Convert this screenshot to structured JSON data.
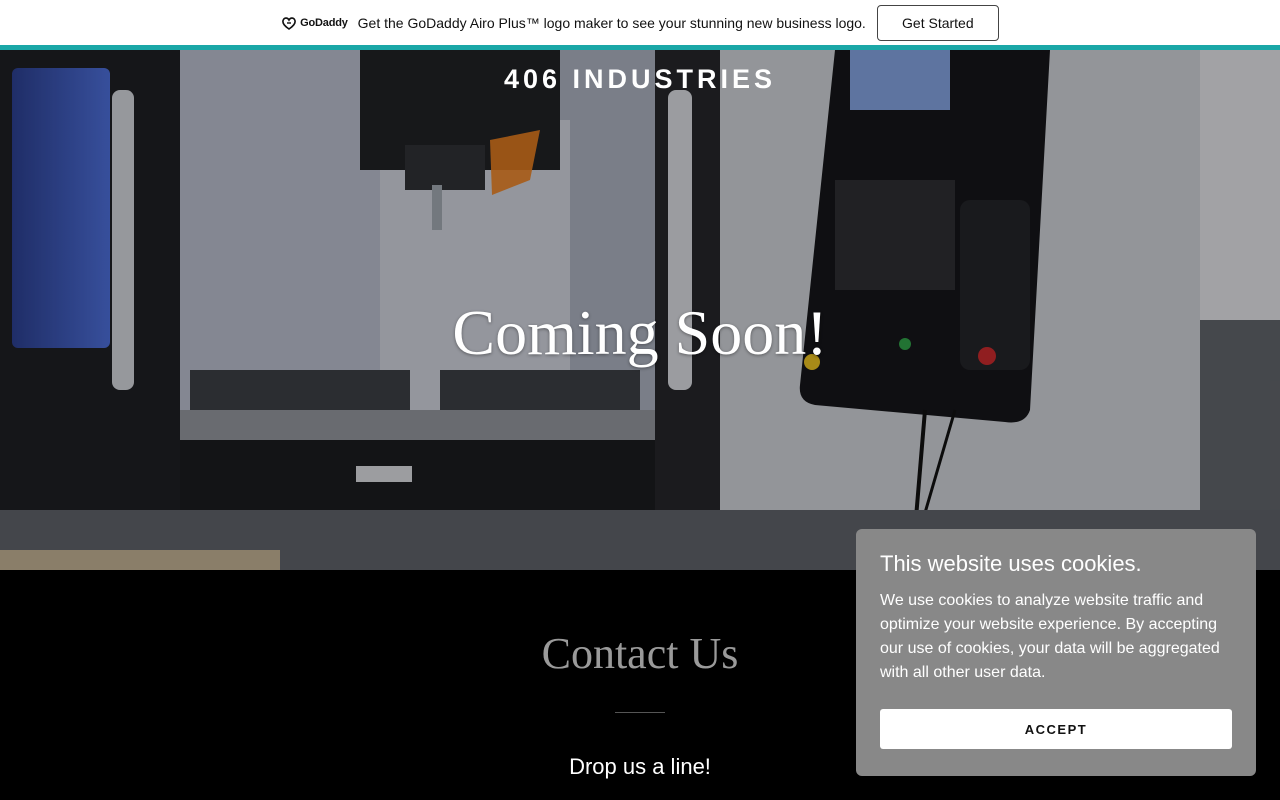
{
  "promo": {
    "logo_text": "GoDaddy",
    "message": "Get the GoDaddy Airo Plus™ logo maker to see your stunning new business logo.",
    "cta_label": "Get Started",
    "accent_color": "#1aa7a7"
  },
  "hero": {
    "brand": "406 INDUSTRIES",
    "headline": "Coming Soon!",
    "image": "cnc-machine-photo"
  },
  "contact": {
    "title": "Contact Us",
    "subtitle": "Drop us a line!"
  },
  "cookie": {
    "title": "This website uses cookies.",
    "body": "We use cookies to analyze website traffic and optimize your website experience. By accepting our use of cookies, your data will be aggregated with all other user data.",
    "accept_label": "ACCEPT"
  }
}
